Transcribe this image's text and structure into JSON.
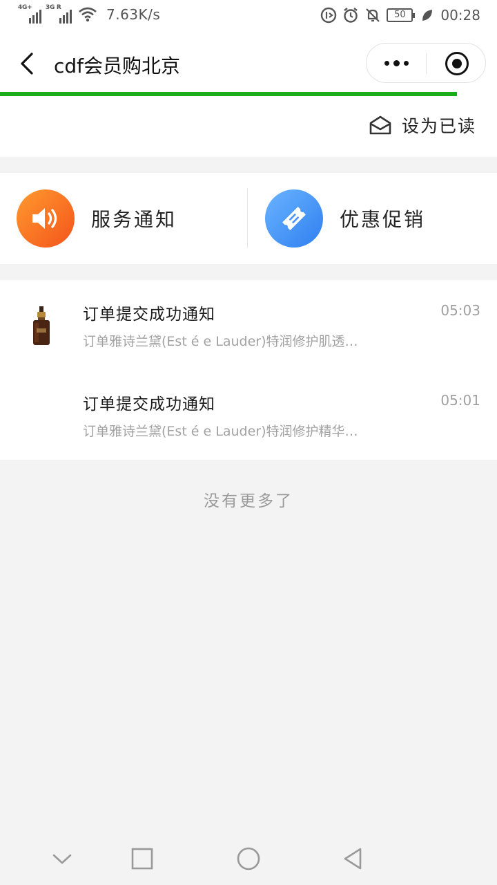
{
  "status_bar": {
    "signal1_tag": "4G+",
    "signal2_tag": "3G R",
    "net_speed": "7.63K/s",
    "battery": "50",
    "time": "00:28"
  },
  "nav": {
    "title": "cdf会员购北京"
  },
  "toolbar": {
    "mark_read_label": "设为已读"
  },
  "categories": [
    {
      "label": "服务通知",
      "icon": "speaker-icon",
      "color": "#f4541c"
    },
    {
      "label": "优惠促销",
      "icon": "coupon-icon",
      "color": "#2f7ff0"
    }
  ],
  "messages": [
    {
      "title": "订单提交成功通知",
      "description": "订单雅诗兰黛(Est é e Lauder)特润修护肌透…",
      "time": "05:03",
      "thumbnail": "serum-bottle-image"
    },
    {
      "title": "订单提交成功通知",
      "description": "订单雅诗兰黛(Est é e Lauder)特润修护精华…",
      "time": "05:01",
      "thumbnail": ""
    }
  ],
  "footer": {
    "no_more": "没有更多了"
  },
  "colors": {
    "progress": "#1aad19",
    "background": "#f3f3f3"
  }
}
